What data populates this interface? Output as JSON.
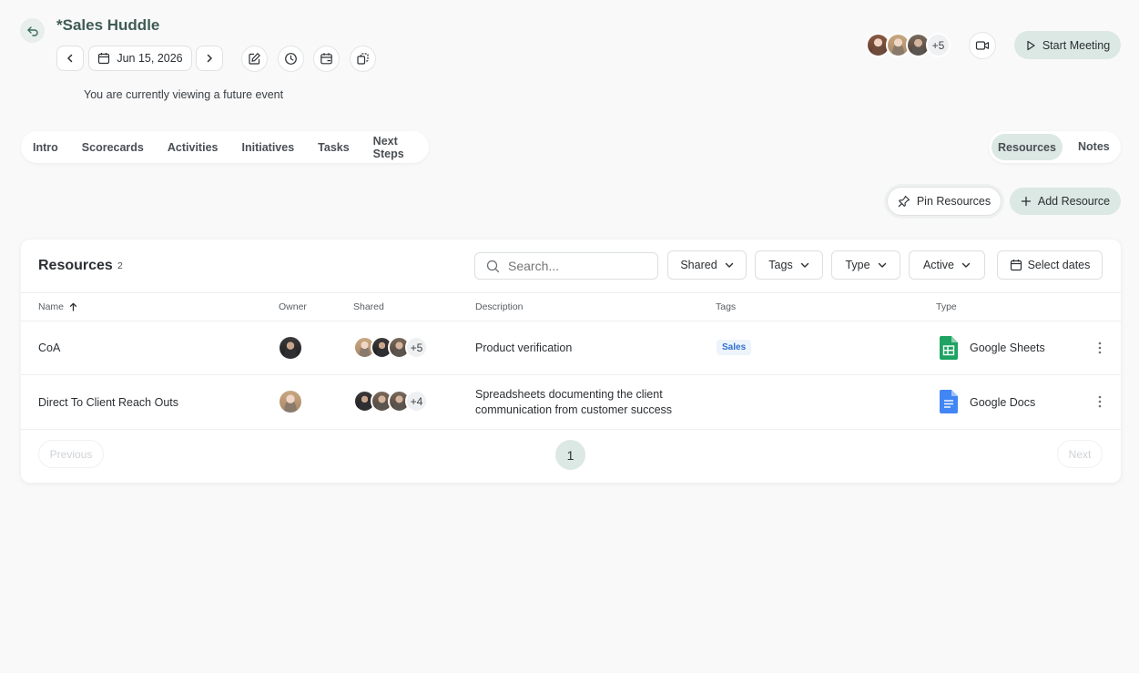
{
  "header": {
    "title": "*Sales Huddle",
    "date": "Jun 15, 2026",
    "future_notice": "You are currently viewing a future event",
    "attendee_more": "+5",
    "start_meeting_label": "Start Meeting"
  },
  "tabs": {
    "left": [
      "Intro",
      "Scorecards",
      "Activities",
      "Initiatives",
      "Tasks",
      "Next Steps"
    ],
    "resources": "Resources",
    "notes": "Notes"
  },
  "actions": {
    "pin_label": "Pin Resources",
    "add_label": "Add Resource"
  },
  "resources": {
    "title": "Resources",
    "count": "2",
    "search_placeholder": "Search...",
    "filters": {
      "shared": "Shared",
      "tags": "Tags",
      "type": "Type",
      "active": "Active",
      "dates": "Select dates"
    },
    "columns": {
      "name": "Name",
      "owner": "Owner",
      "shared": "Shared",
      "description": "Description",
      "tags": "Tags",
      "type": "Type"
    },
    "rows": [
      {
        "name": "CoA",
        "shared_more": "+5",
        "description": "Product verification",
        "tag": "Sales",
        "type": "Google Sheets"
      },
      {
        "name": "Direct To Client Reach Outs",
        "shared_more": "+4",
        "description_line1": "Spreadsheets documenting the client",
        "description_line2": "communication from customer success",
        "type": "Google Docs"
      }
    ],
    "pagination": {
      "previous": "Previous",
      "page": "1",
      "next": "Next"
    }
  },
  "colors": {
    "accent": "#dde9e5",
    "sheets": "#1ea362",
    "docs": "#4285f4",
    "tag_text": "#2f6fd1"
  }
}
